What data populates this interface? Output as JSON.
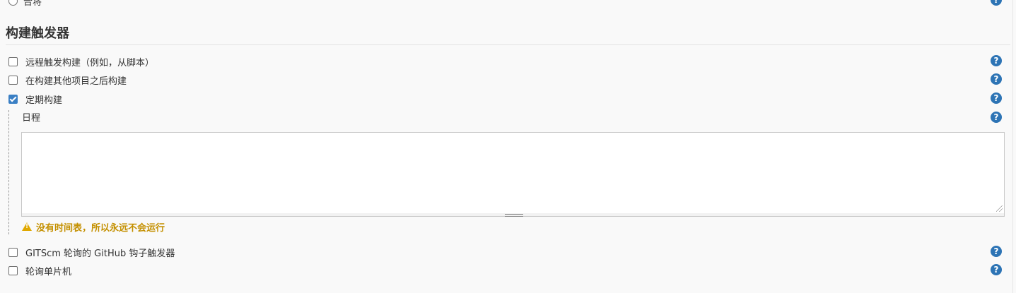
{
  "previous_option": {
    "label": "合将"
  },
  "section": {
    "title": "构建触发器"
  },
  "triggers": [
    {
      "label": "远程触发构建（例如，从脚本）",
      "checked": false
    },
    {
      "label": "在构建其他项目之后构建",
      "checked": false
    },
    {
      "label": "定期构建",
      "checked": true
    }
  ],
  "schedule": {
    "label": "日程",
    "value": "",
    "warning": "没有时间表，所以永远不会运行"
  },
  "more_triggers": [
    {
      "label": "GITScm 轮询的 GitHub 钩子触发器",
      "checked": false
    },
    {
      "label": "轮询单片机",
      "checked": false
    }
  ],
  "help": {
    "glyph": "?",
    "color": "#2d74b5"
  },
  "warning_color": "#c49000",
  "checked_color": "#3a7fc4"
}
